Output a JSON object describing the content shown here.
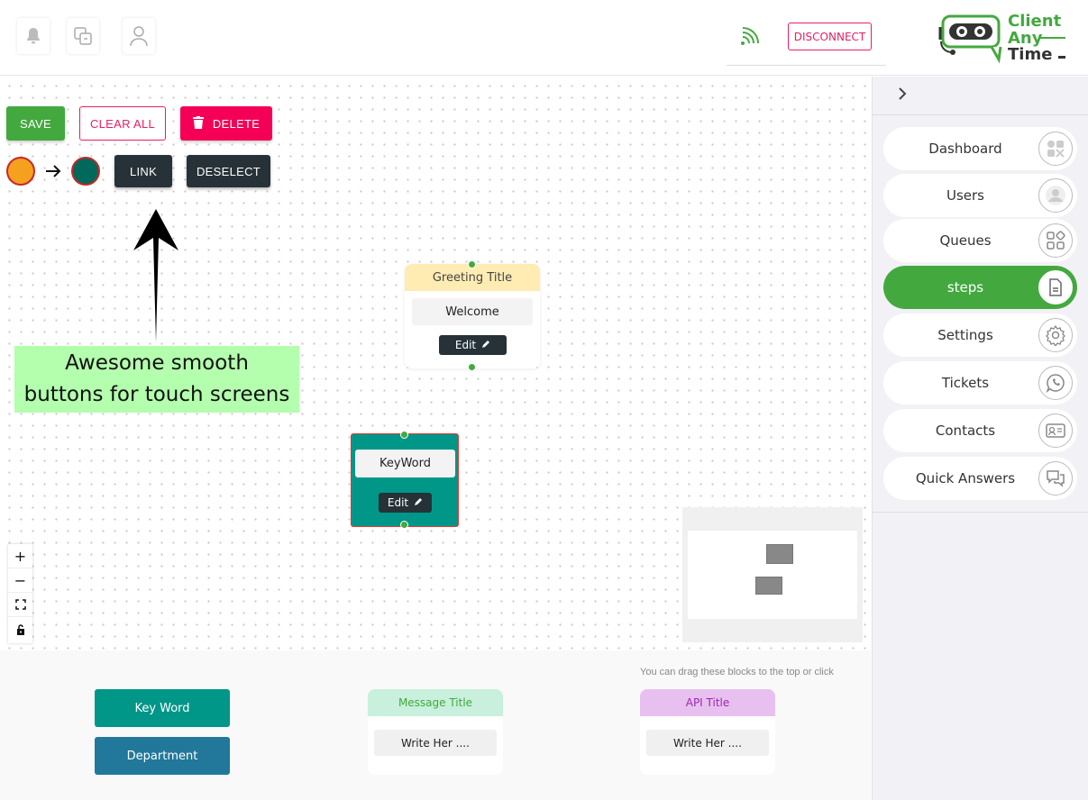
{
  "header": {
    "disconnect_label": "DISCONNECT",
    "icons": [
      "bell-icon",
      "chat-window-icon",
      "user-icon",
      "wifi-signal-icon"
    ],
    "logo": {
      "line1": "Client",
      "line2": "Any",
      "line3": "Time"
    }
  },
  "toolbar": {
    "save_label": "SAVE",
    "clear_label": "CLEAR ALL",
    "delete_label": "DELETE",
    "link_label": "LINK",
    "deselect_label": "DESELECT",
    "link_from_color": "#f5a11f",
    "link_to_color": "#00695c"
  },
  "callout": {
    "line1": "Awesome smooth",
    "line2": "buttons for touch screens"
  },
  "nodes": {
    "greeting": {
      "title": "Greeting Title",
      "body": "Welcome",
      "edit_label": "Edit"
    },
    "keyword": {
      "body": "KeyWord",
      "edit_label": "Edit"
    }
  },
  "palette": {
    "hint": "You can drag these blocks to the top or click",
    "keyword_label": "Key Word",
    "department_label": "Department",
    "message_title": "Message Title",
    "message_body": "Write Her ....",
    "api_title": "API Title",
    "api_body": "Write Her ...."
  },
  "sidebar": {
    "items": [
      {
        "label": "Dashboard",
        "icon": "dashboard-icon"
      },
      {
        "label": "Users",
        "icon": "user-avatar-icon"
      },
      {
        "label": "Queues",
        "icon": "grid-shapes-icon"
      },
      {
        "label": "steps",
        "icon": "document-icon",
        "active": true
      },
      {
        "label": "Settings",
        "icon": "gear-icon"
      },
      {
        "label": "Tickets",
        "icon": "phone-chat-icon"
      },
      {
        "label": "Contacts",
        "icon": "contact-card-icon"
      },
      {
        "label": "Quick Answers",
        "icon": "chat-bubbles-icon"
      }
    ]
  },
  "colors": {
    "brand_green": "#43a93f",
    "accent_pink": "#e91e63",
    "dark": "#263238",
    "teal": "#009688",
    "department_blue": "#22789a"
  }
}
